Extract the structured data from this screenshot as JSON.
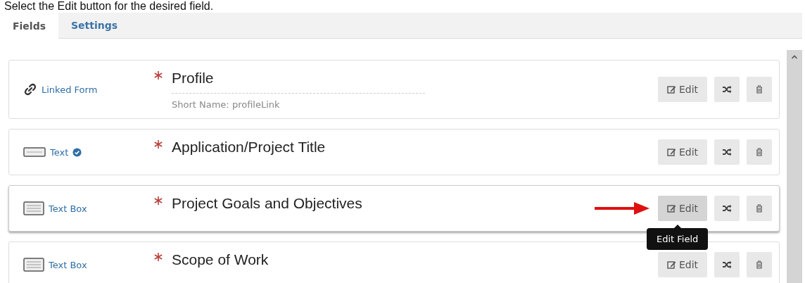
{
  "instruction": "Select the Edit button for the desired field.",
  "tabs": [
    {
      "label": "Fields",
      "selected": true
    },
    {
      "label": "Settings",
      "selected": false
    }
  ],
  "fields": [
    {
      "kind": "link",
      "type_label": "Linked Form",
      "verified": false,
      "required": true,
      "title": "Profile",
      "short_name": "Short Name: profileLink",
      "active": false,
      "edit_label": "Edit"
    },
    {
      "kind": "text",
      "type_label": "Text",
      "verified": true,
      "required": true,
      "title": "Application/Project Title",
      "active": false,
      "edit_label": "Edit"
    },
    {
      "kind": "textbox",
      "type_label": "Text Box",
      "verified": false,
      "required": true,
      "title": "Project Goals and Objectives",
      "active": true,
      "edit_label": "Edit",
      "tooltip": "Edit Field"
    },
    {
      "kind": "textbox",
      "type_label": "Text Box",
      "verified": false,
      "required": true,
      "title": "Scope of Work",
      "active": false,
      "edit_label": "Edit"
    }
  ]
}
